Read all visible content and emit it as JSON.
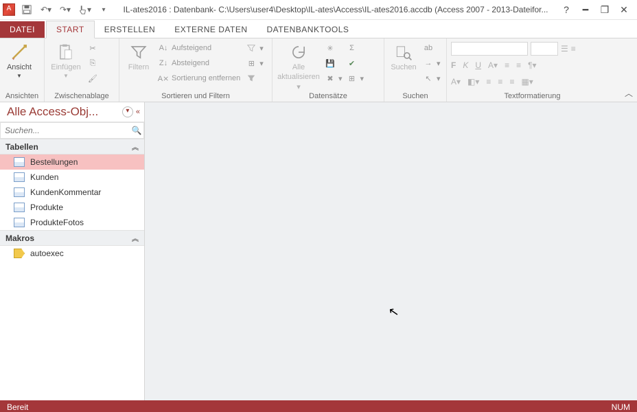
{
  "title": "IL-ates2016 : Datenbank- C:\\Users\\user4\\Desktop\\IL-ates\\Access\\IL-ates2016.accdb (Access 2007 - 2013-Dateifor...",
  "tabs": {
    "datei": "DATEI",
    "start": "START",
    "erstellen": "ERSTELLEN",
    "externe": "EXTERNE DATEN",
    "tools": "DATENBANKTOOLS"
  },
  "ribbon": {
    "ansichten": {
      "label": "Ansichten",
      "ansicht": "Ansicht"
    },
    "zwischenablage": {
      "label": "Zwischenablage",
      "einfuegen": "Einfügen"
    },
    "sortfilter": {
      "label": "Sortieren und Filtern",
      "filtern": "Filtern",
      "auf": "Aufsteigend",
      "ab": "Absteigend",
      "entf": "Sortierung entfernen"
    },
    "datensaetze": {
      "label": "Datensätze",
      "alle1": "Alle",
      "alle2": "aktualisieren"
    },
    "suchen": {
      "label": "Suchen",
      "btn": "Suchen"
    },
    "textfmt": {
      "label": "Textformatierung"
    }
  },
  "nav": {
    "title": "Alle Access-Obj...",
    "search_placeholder": "Suchen...",
    "groups": {
      "tabellen": "Tabellen",
      "makros": "Makros"
    },
    "tables": [
      "Bestellungen",
      "Kunden",
      "KundenKommentar",
      "Produkte",
      "ProdukteFotos"
    ],
    "macros": [
      "autoexec"
    ]
  },
  "status": {
    "left": "Bereit",
    "right": "NUM"
  }
}
